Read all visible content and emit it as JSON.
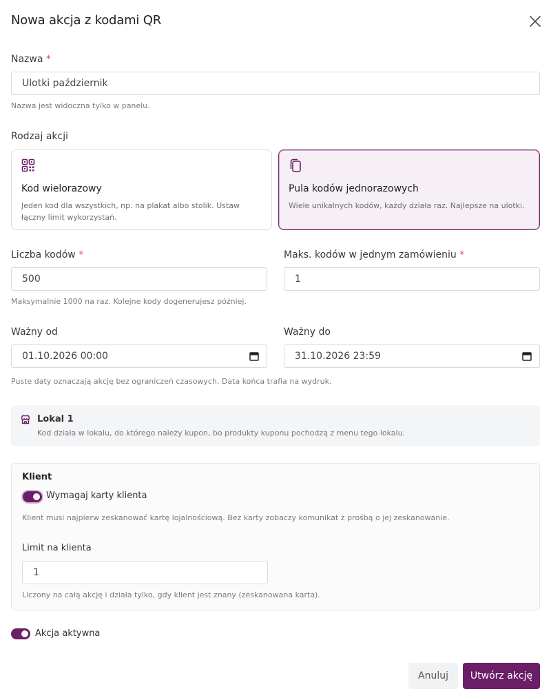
{
  "dialog": {
    "title": "Nowa akcja z kodami QR",
    "close_icon": "close-icon"
  },
  "name": {
    "label": "Nazwa",
    "required_mark": "*",
    "value": "Ulotki październik",
    "help": "Nazwa jest widoczna tylko w panelu."
  },
  "action_type": {
    "label": "Rodzaj akcji",
    "options": [
      {
        "title": "Kod wielorazowy",
        "description": "Jeden kod dla wszystkich, np. na plakat albo stolik. Ustaw łączny limit wykorzystań.",
        "icon": "qr-code-icon",
        "selected": false
      },
      {
        "title": "Pula kodów jednorazowych",
        "description": "Wiele unikalnych kodów, każdy działa raz. Najlepsze na ulotki.",
        "icon": "copy-icon",
        "selected": true
      }
    ]
  },
  "codes_count": {
    "label": "Liczba kodów",
    "required_mark": "*",
    "value": "500",
    "help": "Maksymalnie 1000 na raz. Kolejne kody dogenerujesz później."
  },
  "max_per_order": {
    "label": "Maks. kodów w jednym zamówieniu",
    "required_mark": "*",
    "value": "1"
  },
  "valid_from": {
    "label": "Ważny od",
    "value": "01.10.2026 00:00"
  },
  "valid_to": {
    "label": "Ważny do",
    "value": "31.10.2026 23:59"
  },
  "dates_help": "Puste daty oznaczają akcję bez ograniczeń czasowych. Data końca trafia na wydruk.",
  "location": {
    "title": "Lokal 1",
    "description": "Kod działa w lokalu, do którego należy kupon, bo produkty kuponu pochodzą z menu tego lokalu.",
    "icon": "store-icon"
  },
  "client": {
    "heading": "Klient",
    "require_card_label": "Wymagaj karty klienta",
    "require_card_on": true,
    "require_card_help": "Klient musi najpierw zeskanować kartę lojalnościową. Bez karty zobaczy komunikat z prośbą o jej zeskanowanie.",
    "limit_label": "Limit na klienta",
    "limit_value": "1",
    "limit_help": "Liczony na całą akcję i działa tylko, gdy klient jest znany (zeskanowana karta)."
  },
  "active": {
    "label": "Akcja aktywna",
    "on": true
  },
  "footer": {
    "cancel_label": "Anuluj",
    "submit_label": "Utwórz akcję"
  },
  "colors": {
    "accent": "#6b1d67",
    "required": "#d9534f"
  }
}
